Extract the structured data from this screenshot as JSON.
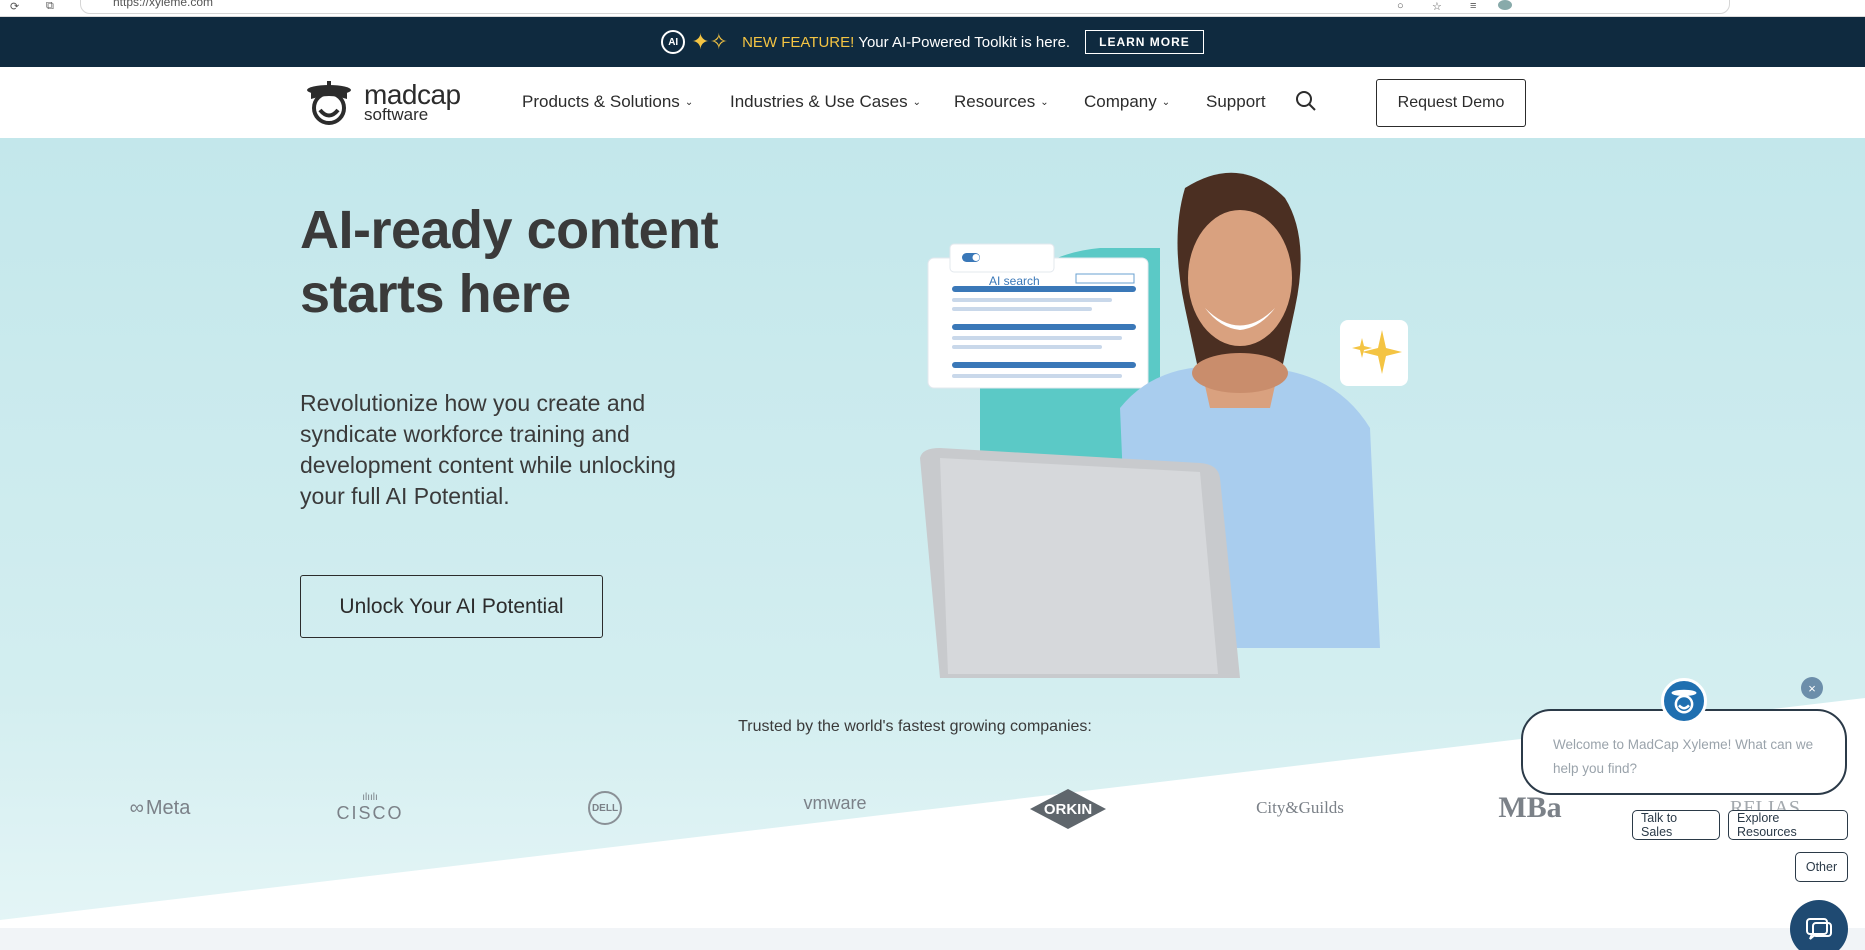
{
  "browser": {
    "url": "https://xyleme.com"
  },
  "announcement": {
    "ai_badge": "AI",
    "new_feature": "NEW FEATURE!",
    "message": "Your AI-Powered Toolkit is here.",
    "learn_more": "LEARN MORE"
  },
  "nav": {
    "logo_line1": "madcap",
    "logo_line2": "software",
    "items": [
      {
        "label": "Products & Solutions"
      },
      {
        "label": "Industries & Use Cases"
      },
      {
        "label": "Resources"
      },
      {
        "label": "Company"
      },
      {
        "label": "Support"
      }
    ],
    "request_demo": "Request Demo"
  },
  "hero": {
    "title": "AI-ready content starts here",
    "subtitle": "Revolutionize how you create and syndicate workforce training and development content while unlocking your full AI Potential.",
    "cta": "Unlock Your AI Potential",
    "ai_search_label": "AI search"
  },
  "trusted": {
    "heading": "Trusted by the world's fastest growing companies:",
    "logos": [
      "Meta",
      "CISCO",
      "DELL",
      "vmware",
      "ORKIN",
      "City&Guilds",
      "MBa",
      "RELIAS"
    ]
  },
  "chat": {
    "welcome": "Welcome to MadCap Xyleme! What can we help you find?",
    "options": [
      "Talk to Sales",
      "Explore Resources",
      "Other"
    ],
    "close": "×"
  },
  "colors": {
    "announce_bg": "#0f2a3f",
    "accent_yellow": "#f4c443",
    "hero_bg": "#c3e7eb",
    "text_dark": "#2c2c2c",
    "chat_blue": "#1f4a72"
  }
}
